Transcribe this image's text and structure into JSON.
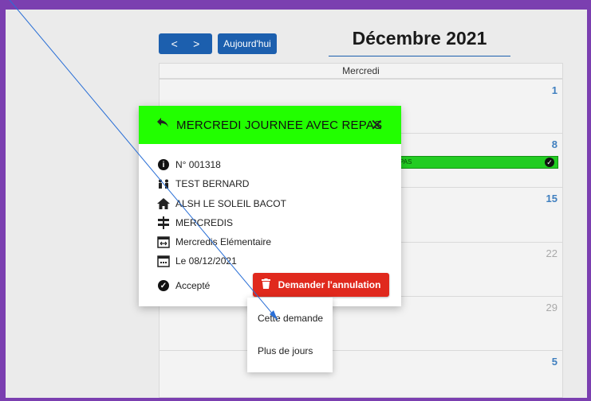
{
  "toolbar": {
    "prev": "<",
    "next": ">",
    "today": "Aujourd'hui",
    "month": "Décembre 2021"
  },
  "calendar": {
    "day_header": "Mercredi",
    "weeks": [
      {
        "day": "1",
        "faded": false
      },
      {
        "day": "8",
        "faded": false
      },
      {
        "day": "15",
        "faded": false
      },
      {
        "day": "22",
        "faded": true
      },
      {
        "day": "29",
        "faded": true
      },
      {
        "day": "5",
        "faded": false
      }
    ],
    "event_text": "PAS"
  },
  "modal": {
    "title": "MERCREDI JOURNEE AVEC REPAS",
    "rows": {
      "number": "N° 001318",
      "person": "TEST BERNARD",
      "place": "ALSH LE SOLEIL BACOT",
      "category": "MERCREDIS",
      "group": "Mercredis Elémentaire",
      "date": "Le 08/12/2021",
      "status": "Accepté"
    },
    "cancel_label": "Demander l'annulation"
  },
  "dropdown": {
    "items": [
      "Cette demande",
      "Plus de jours"
    ]
  },
  "colors": {
    "frame": "#7b3fb0",
    "primary": "#1c5fae",
    "modal_header": "#22ff00",
    "event": "#22cc22",
    "danger": "#e0291d"
  }
}
